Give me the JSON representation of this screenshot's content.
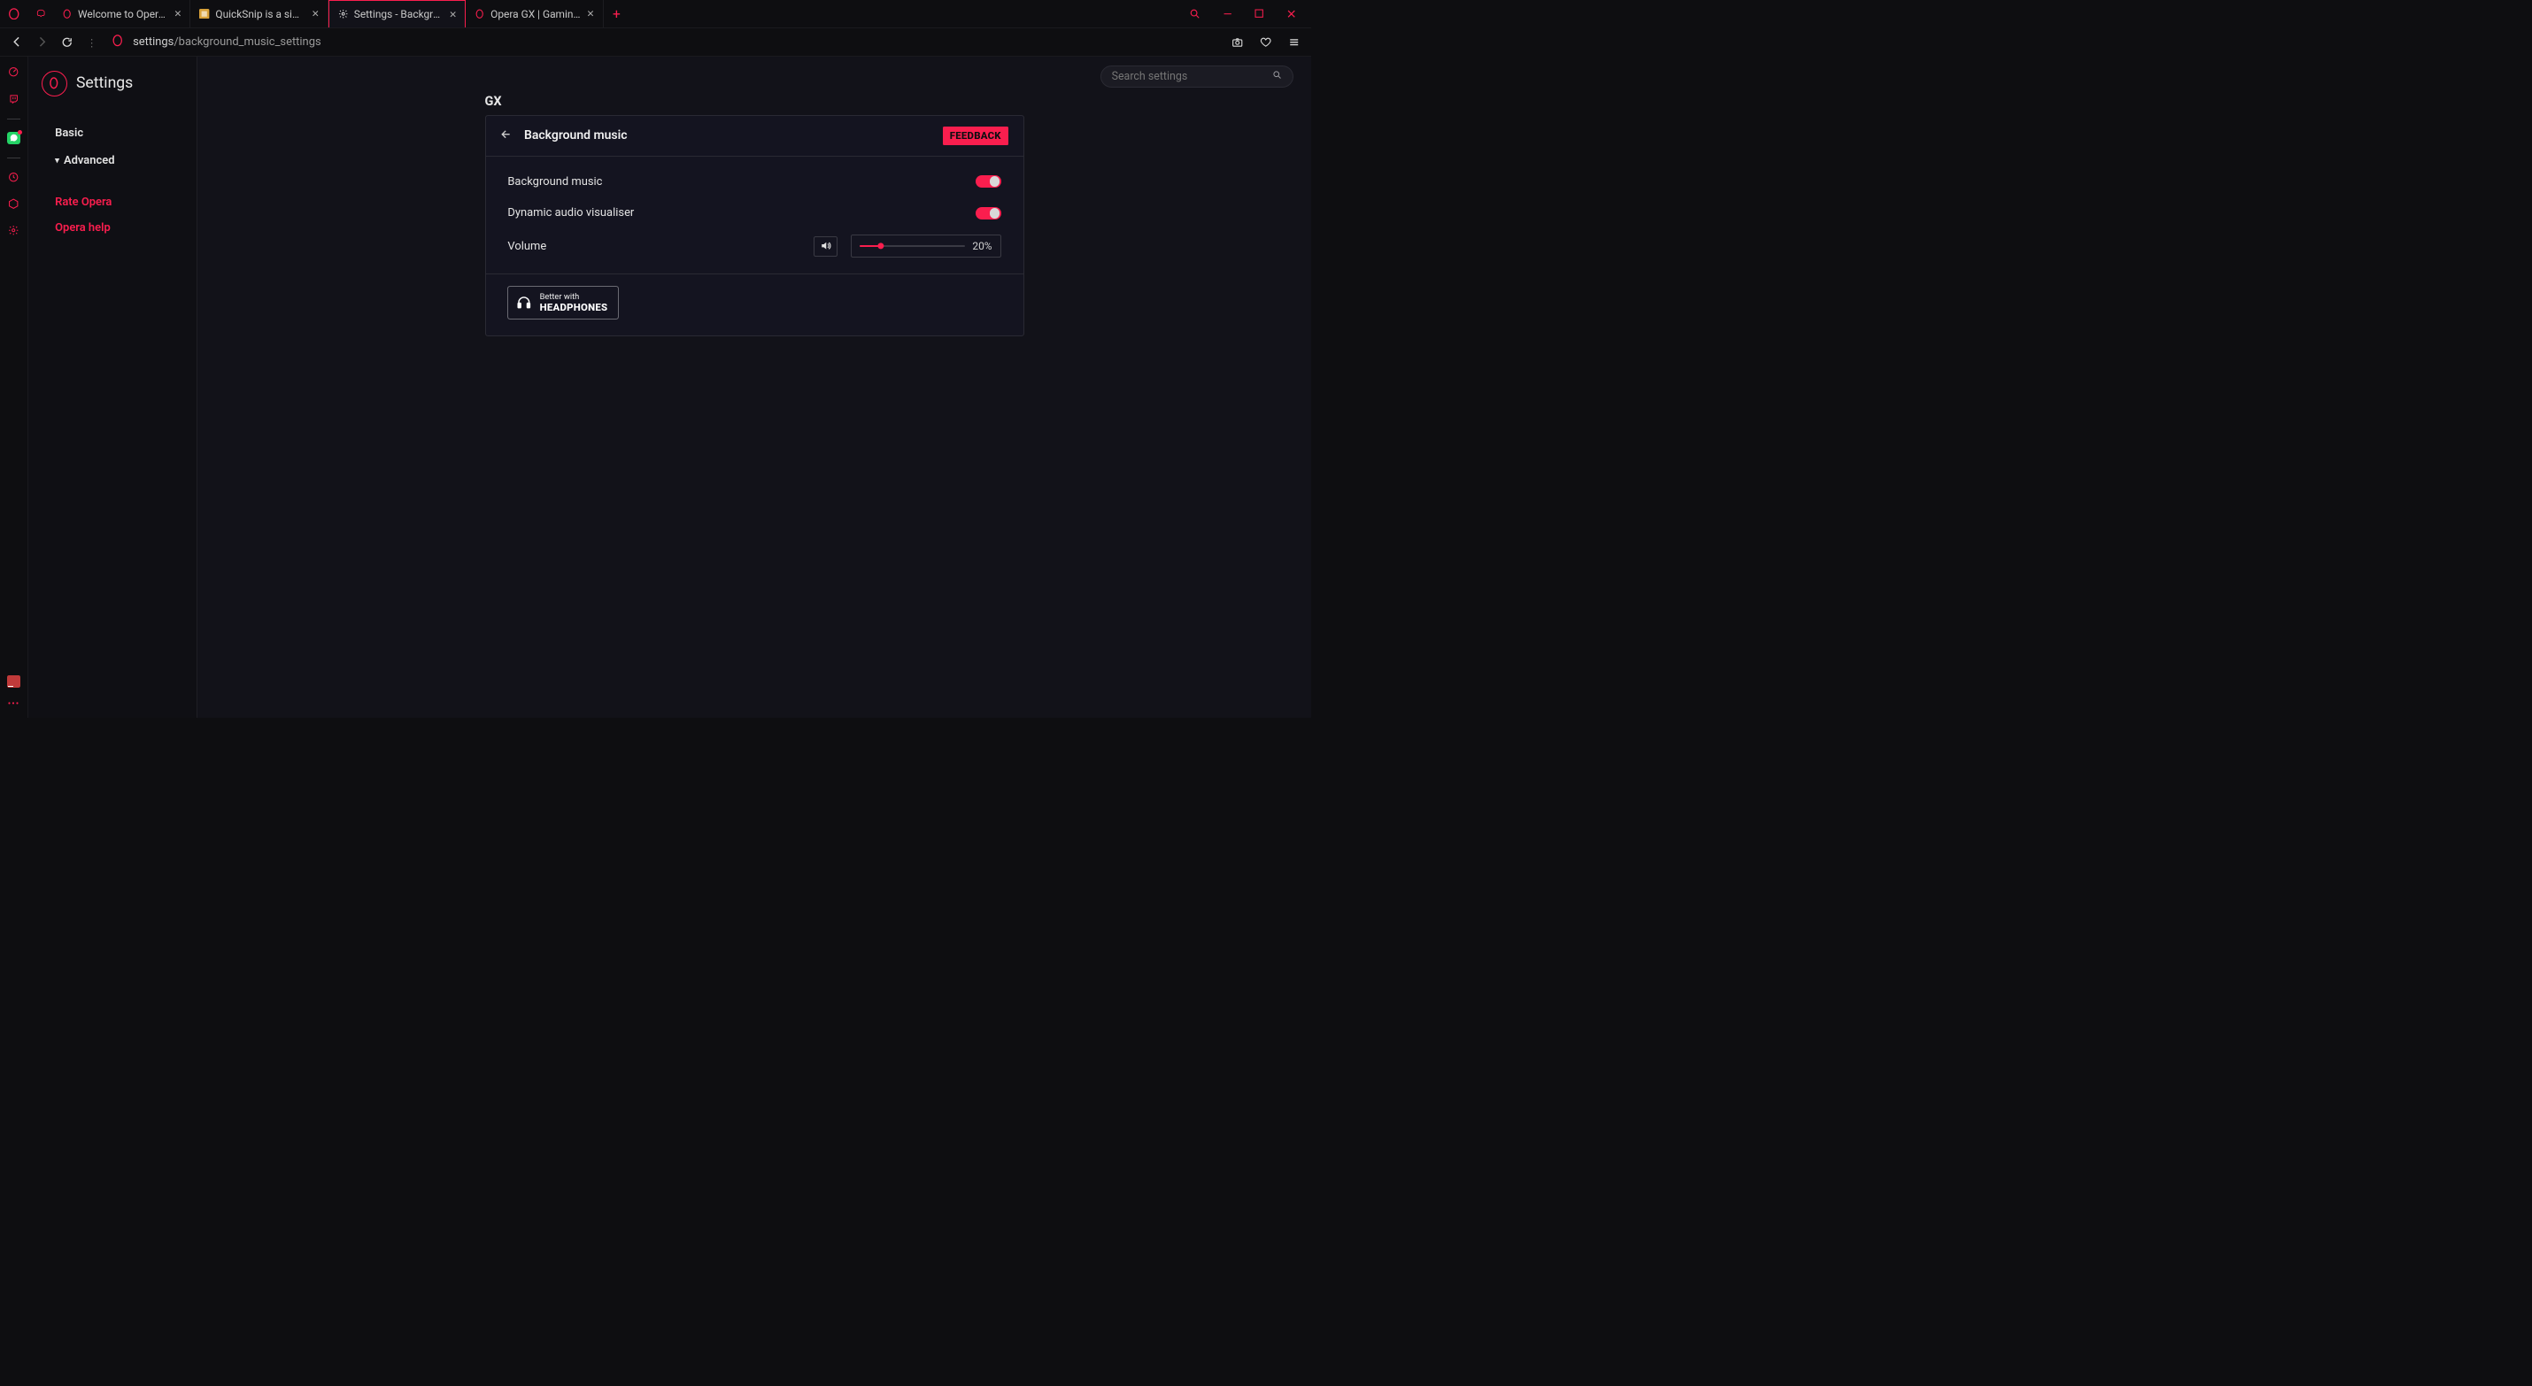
{
  "accent": "#fa1e4e",
  "window": {
    "tabs": [
      {
        "label": "Welcome to Opera GX!",
        "favicon": "opera"
      },
      {
        "label": "QuickSnip is a simple scree",
        "favicon": "quicksnip"
      },
      {
        "label": "Settings - Background mus",
        "favicon": "gear",
        "active": true
      },
      {
        "label": "Opera GX | Gaming Browse",
        "favicon": "opera"
      }
    ]
  },
  "addressbar": {
    "host": "settings",
    "path": "/background_music_settings"
  },
  "settings": {
    "title": "Settings",
    "nav": {
      "basic": "Basic",
      "advanced": "Advanced",
      "rate": "Rate Opera",
      "help": "Opera help"
    },
    "search_placeholder": "Search settings"
  },
  "section": {
    "heading": "GX",
    "panel_title": "Background music",
    "feedback": "FEEDBACK",
    "rows": {
      "bg_music": "Background music",
      "visualiser": "Dynamic audio visualiser",
      "volume": "Volume"
    },
    "volume_percent": "20%",
    "headphones": {
      "small": "Better with",
      "big": "HEADPHONES"
    }
  }
}
